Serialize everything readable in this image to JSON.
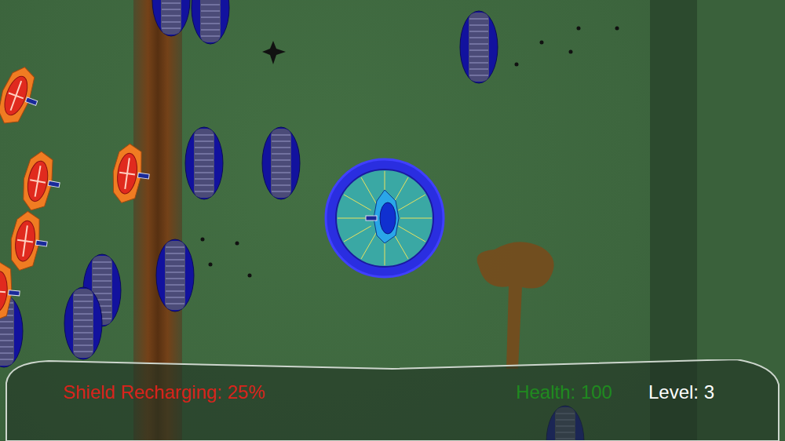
{
  "hud": {
    "items": [
      {
        "text": "Shield Recharging: 25%",
        "color": "#d8231b"
      },
      {
        "text": "Health: 100",
        "color": "#1f8a1f"
      },
      {
        "text": "Level: 3",
        "color": "#ffffff"
      }
    ]
  },
  "units": [
    {
      "kind": "pod"
    },
    {
      "kind": "pod"
    },
    {
      "kind": "pod"
    },
    {
      "kind": "pod"
    },
    {
      "kind": "pod"
    },
    {
      "kind": "pod"
    },
    {
      "kind": "pod"
    },
    {
      "kind": "pod"
    },
    {
      "kind": "pod"
    },
    {
      "kind": "pod"
    },
    {
      "kind": "enemy"
    },
    {
      "kind": "enemy"
    },
    {
      "kind": "enemy"
    },
    {
      "kind": "enemy"
    },
    {
      "kind": "enemy"
    }
  ],
  "player": {
    "shielded": true
  }
}
